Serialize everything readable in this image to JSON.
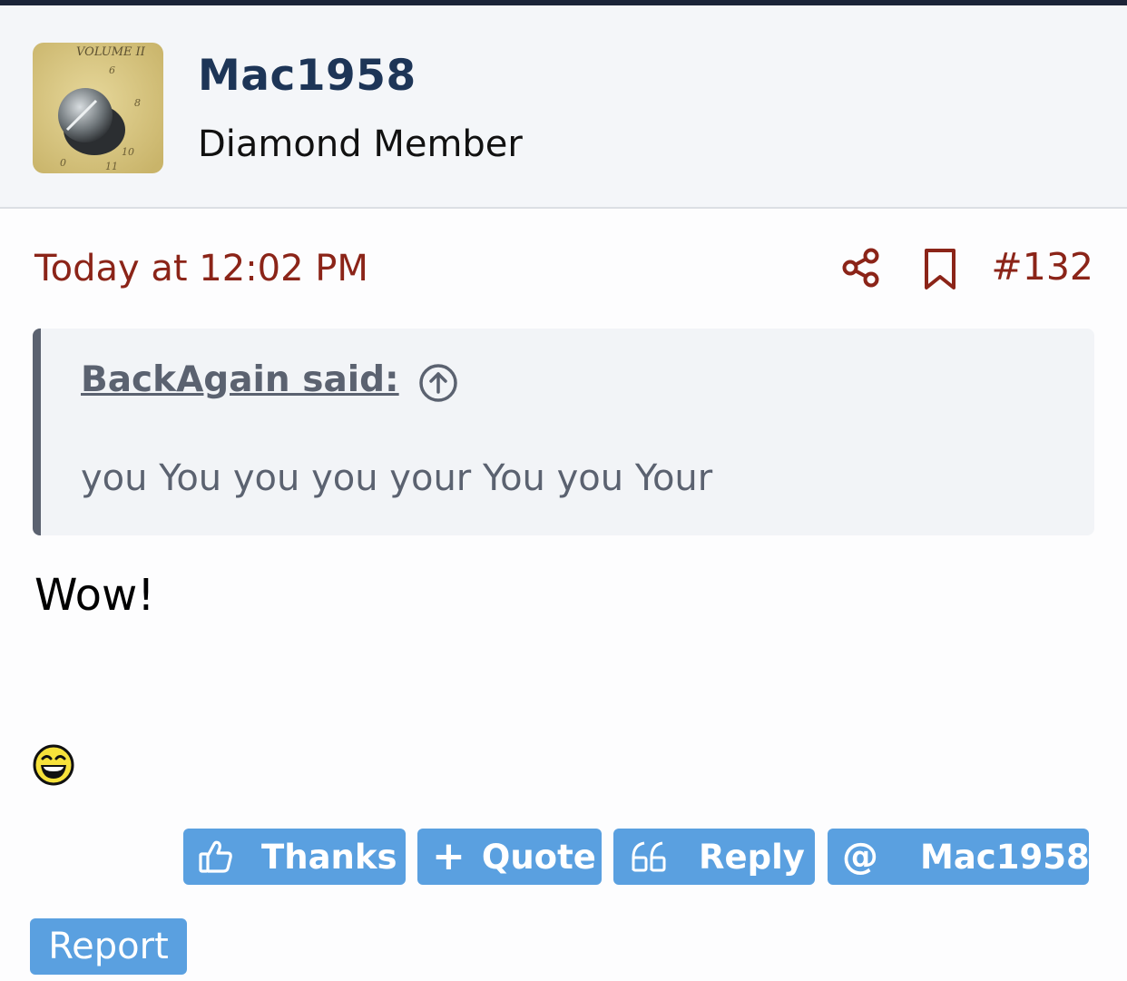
{
  "user": {
    "name": "Mac1958",
    "title": "Diamond Member",
    "avatar": {
      "icon": "volume-knob-avatar",
      "dial_label": "VOLUME II"
    }
  },
  "post": {
    "date": "Today at 12:02 PM",
    "number": "#132",
    "body": "Wow!",
    "emoji": "laughing-emoji"
  },
  "quote": {
    "author": "BackAgain said:",
    "text": "you You you you your You you Your"
  },
  "actions": {
    "thanks": "Thanks",
    "quote": "Quote",
    "reply": "Reply",
    "mention": "Mac1958",
    "report": "Report"
  },
  "colors": {
    "accent": "#8b2418",
    "username": "#1d3557",
    "button": "#5aa0e0",
    "quote_border": "#5b6270"
  }
}
